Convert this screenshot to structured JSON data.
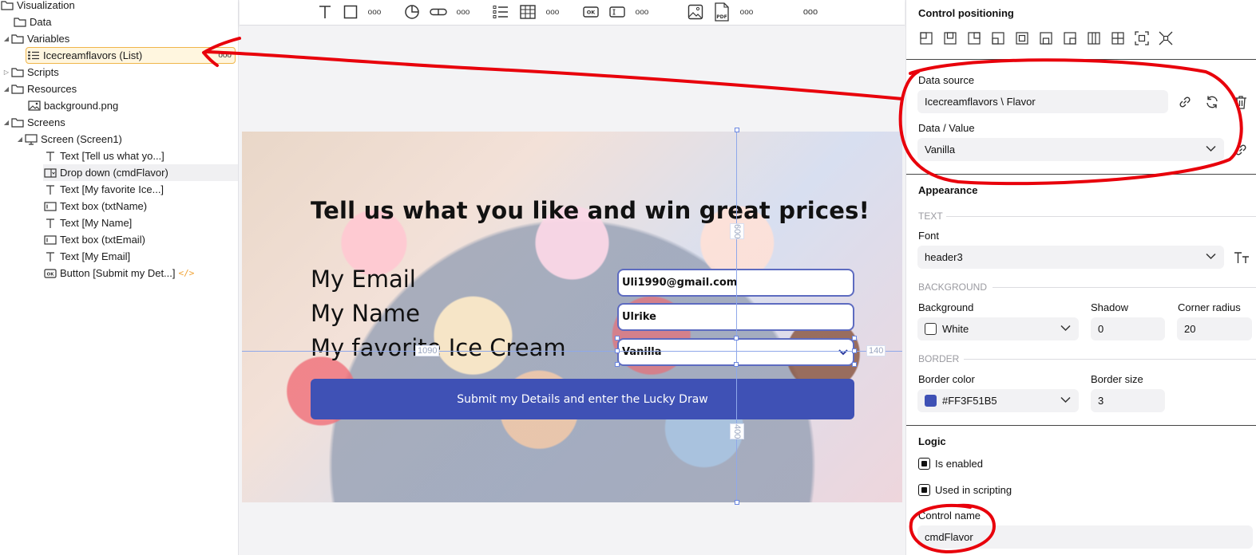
{
  "tree": {
    "items": [
      {
        "label": "Visualization",
        "icon": "folder-icon"
      },
      {
        "label": "Data",
        "icon": "folder-icon"
      },
      {
        "label": "Variables",
        "icon": "folder-icon"
      },
      {
        "label": "Icecreamflavors (List)",
        "icon": "list-icon"
      },
      {
        "label": "Scripts",
        "icon": "folder-icon"
      },
      {
        "label": "Resources",
        "icon": "folder-icon"
      },
      {
        "label": "background.png",
        "icon": "image-icon"
      },
      {
        "label": "Screens",
        "icon": "folder-icon"
      },
      {
        "label": "Screen (Screen1)",
        "icon": "monitor-icon"
      },
      {
        "label": "Text [Tell us what yo...]",
        "icon": "text-icon"
      },
      {
        "label": "Drop down  (cmdFlavor)",
        "icon": "dropdown-icon"
      },
      {
        "label": "Text [My favorite Ice...]",
        "icon": "text-icon"
      },
      {
        "label": "Text box  (txtName)",
        "icon": "textbox-icon"
      },
      {
        "label": "Text [My Name]",
        "icon": "text-icon"
      },
      {
        "label": "Text box  (txtEmail)",
        "icon": "textbox-icon"
      },
      {
        "label": "Text [My Email]",
        "icon": "text-icon"
      },
      {
        "label": "Button [Submit my Det...]",
        "icon": "button-icon"
      }
    ],
    "more_label": "ooo",
    "code_tag": "</>"
  },
  "toolbar": {
    "more_label": "ooo",
    "ok_label": "OK",
    "pdf_label": "PDF"
  },
  "canvas": {
    "headline": "Tell us what you like and win great prices!",
    "label_email": "My Email",
    "label_name": "My Name",
    "label_flavor": "My favorite Ice Cream",
    "email_value": "Uli1990@gmail.com",
    "name_value": "Ulrike",
    "flavor_value": "Vanilla",
    "submit_label": "Submit my Details and enter the Lucky Draw",
    "dim_top": "600",
    "dim_left": "1090",
    "dim_right": "140",
    "dim_bottom": "400"
  },
  "props": {
    "positioning_title": "Control positioning",
    "data_source_label": "Data source",
    "data_source_value": "Icecreamflavors \\ Flavor",
    "data_value_label": "Data / Value",
    "data_value_value": "Vanilla",
    "appearance_title": "Appearance",
    "text_section": "TEXT",
    "font_label": "Font",
    "font_value": "header3",
    "background_section": "BACKGROUND",
    "background_label": "Background",
    "background_value": "White",
    "shadow_label": "Shadow",
    "shadow_value": "0",
    "corner_label": "Corner radius",
    "corner_value": "20",
    "border_section": "BORDER",
    "border_color_label": "Border color",
    "border_color_value": "#FF3F51B5",
    "border_size_label": "Border size",
    "border_size_value": "3",
    "logic_title": "Logic",
    "enabled_label": "Is enabled",
    "scripting_label": "Used in scripting",
    "control_name_label": "Control name",
    "control_name_value": "cmdFlavor"
  },
  "colors": {
    "accent": "#3f51b5",
    "border_swatch": "#3f51b5",
    "annotation": "#e8000b",
    "selection": "#f0b64a"
  }
}
